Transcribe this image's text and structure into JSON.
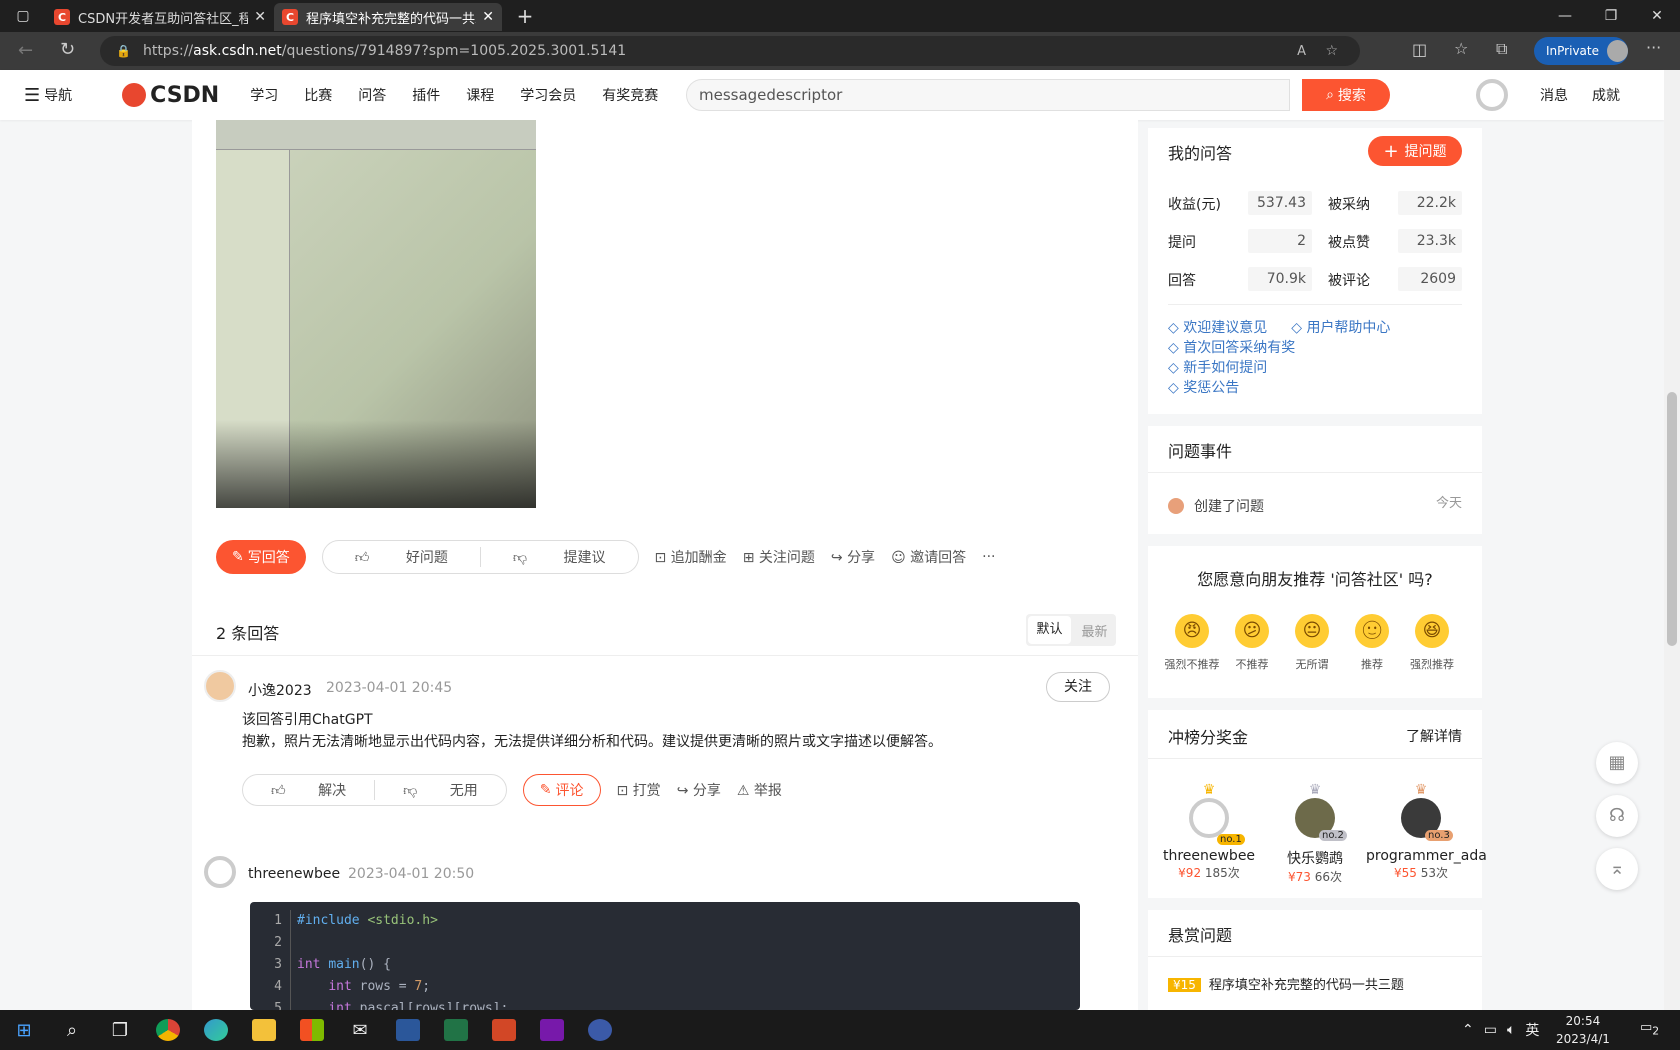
{
  "browser": {
    "tabs": [
      {
        "title": "CSDN开发者互助问答社区_程序员",
        "favicon": "C",
        "active": false
      },
      {
        "title": "程序填空补充完整的代码一共三题",
        "favicon": "C",
        "active": true
      }
    ],
    "url_prefix": "https://",
    "url_host": "ask.csdn.net",
    "url_path": "/questions/7914897?spm=1005.2025.3001.5141",
    "inprivate": "InPrivate"
  },
  "nav": {
    "menu": "导航",
    "logo": "CSDN",
    "links": [
      "学习",
      "比赛",
      "问答",
      "插件",
      "课程",
      "学习会员",
      "有奖竞赛"
    ],
    "search_value": "messagedescriptor",
    "search_button": "搜索",
    "right": [
      "消息",
      "成就"
    ]
  },
  "question_actions": {
    "write": "写回答",
    "good": "好问题",
    "suggest": "提建议",
    "bounty": "追加酬金",
    "follow": "关注问题",
    "share": "分享",
    "invite": "邀请回答",
    "more": "···"
  },
  "answers_header": {
    "count": "2 条回答",
    "sort_default": "默认",
    "sort_latest": "最新"
  },
  "answer1": {
    "user": "小逸2023",
    "date": "2023-04-01 20:45",
    "follow": "关注",
    "line1": "该回答引用ChatGPT",
    "line2": "抱歉，照片无法清晰地显示出代码内容，无法提供详细分析和代码。建议提供更清晰的照片或文字描述以便解答。",
    "solve": "解决",
    "useless": "无用",
    "comment": "评论",
    "tip": "打赏",
    "share": "分享",
    "report": "举报"
  },
  "answer2": {
    "user": "threenewbee",
    "date": "2023-04-01 20:50",
    "line_numbers": [
      "1",
      "2",
      "3",
      "4",
      "5"
    ]
  },
  "sidebar": {
    "my_qa": "我的问答",
    "ask_button": "提问题",
    "stats": [
      {
        "label": "收益(元)",
        "value": "537.43"
      },
      {
        "label": "被采纳",
        "value": "22.2k"
      },
      {
        "label": "提问",
        "value": "2"
      },
      {
        "label": "被点赞",
        "value": "23.3k"
      },
      {
        "label": "回答",
        "value": "70.9k"
      },
      {
        "label": "被评论",
        "value": "2609"
      }
    ],
    "links": [
      "欢迎建议意见",
      "用户帮助中心",
      "首次回答采纳有奖",
      "新手如何提问",
      "奖惩公告"
    ],
    "event_title": "问题事件",
    "event_text": "创建了问题",
    "event_time": "今天",
    "recommend_q": "您愿意向朋友推荐 '问答社区' 吗?",
    "emotions": [
      "强烈不推荐",
      "不推荐",
      "无所谓",
      "推荐",
      "强烈推荐"
    ],
    "rank_title": "冲榜分奖金",
    "rank_more": "了解详情",
    "ranks": [
      {
        "no": "no.1",
        "name": "threenewbee",
        "money": "¥92",
        "times": "185次"
      },
      {
        "no": "no.2",
        "name": "快乐鹦鹉",
        "money": "¥73",
        "times": "66次"
      },
      {
        "no": "no.3",
        "name": "programmer_ada",
        "money": "¥55",
        "times": "53次"
      }
    ],
    "bounty_title": "悬赏问题",
    "bounty_badge": "¥15",
    "bounty_q": "程序填空补充完整的代码一共三题"
  },
  "taskbar": {
    "ime": "英",
    "time": "20:54",
    "date": "2023/4/1",
    "notif": "2"
  }
}
